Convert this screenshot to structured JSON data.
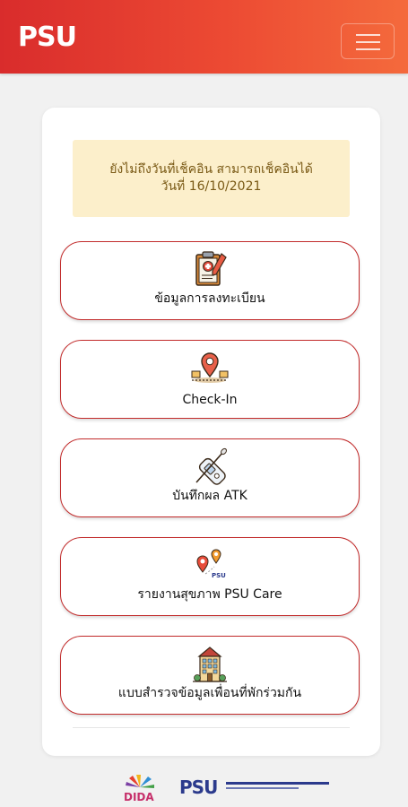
{
  "header": {
    "logo_text": "PSU",
    "menu_icon": "hamburger-icon",
    "gradient": [
      "#d92c2c",
      "#f46a3c"
    ]
  },
  "notice": {
    "line1": "ยังไม่ถึงวันที่เช็คอิน สามารถเช็คอินได้",
    "line2": "วันที่ 16/10/2021"
  },
  "menu": [
    {
      "icon": "clipboard-medical-icon",
      "label": "ข้อมูลการลงทะเบียน"
    },
    {
      "icon": "map-pin-icon",
      "label": "Check-In"
    },
    {
      "icon": "swab-test-icon",
      "label": "บันทึกผล ATK"
    },
    {
      "icon": "route-pins-icon",
      "label": "รายงานสุขภาพ PSU Care"
    },
    {
      "icon": "building-icon",
      "label": "แบบสำรวจข้อมูลเพื่อนที่พักร่วมกัน"
    }
  ],
  "footer": {
    "dida_logo": "DIDA",
    "psu_logo": "PSU"
  },
  "colors": {
    "accent": "#c22b2b",
    "notice_bg": "#fcefcb",
    "notice_text": "#7a5a16"
  }
}
